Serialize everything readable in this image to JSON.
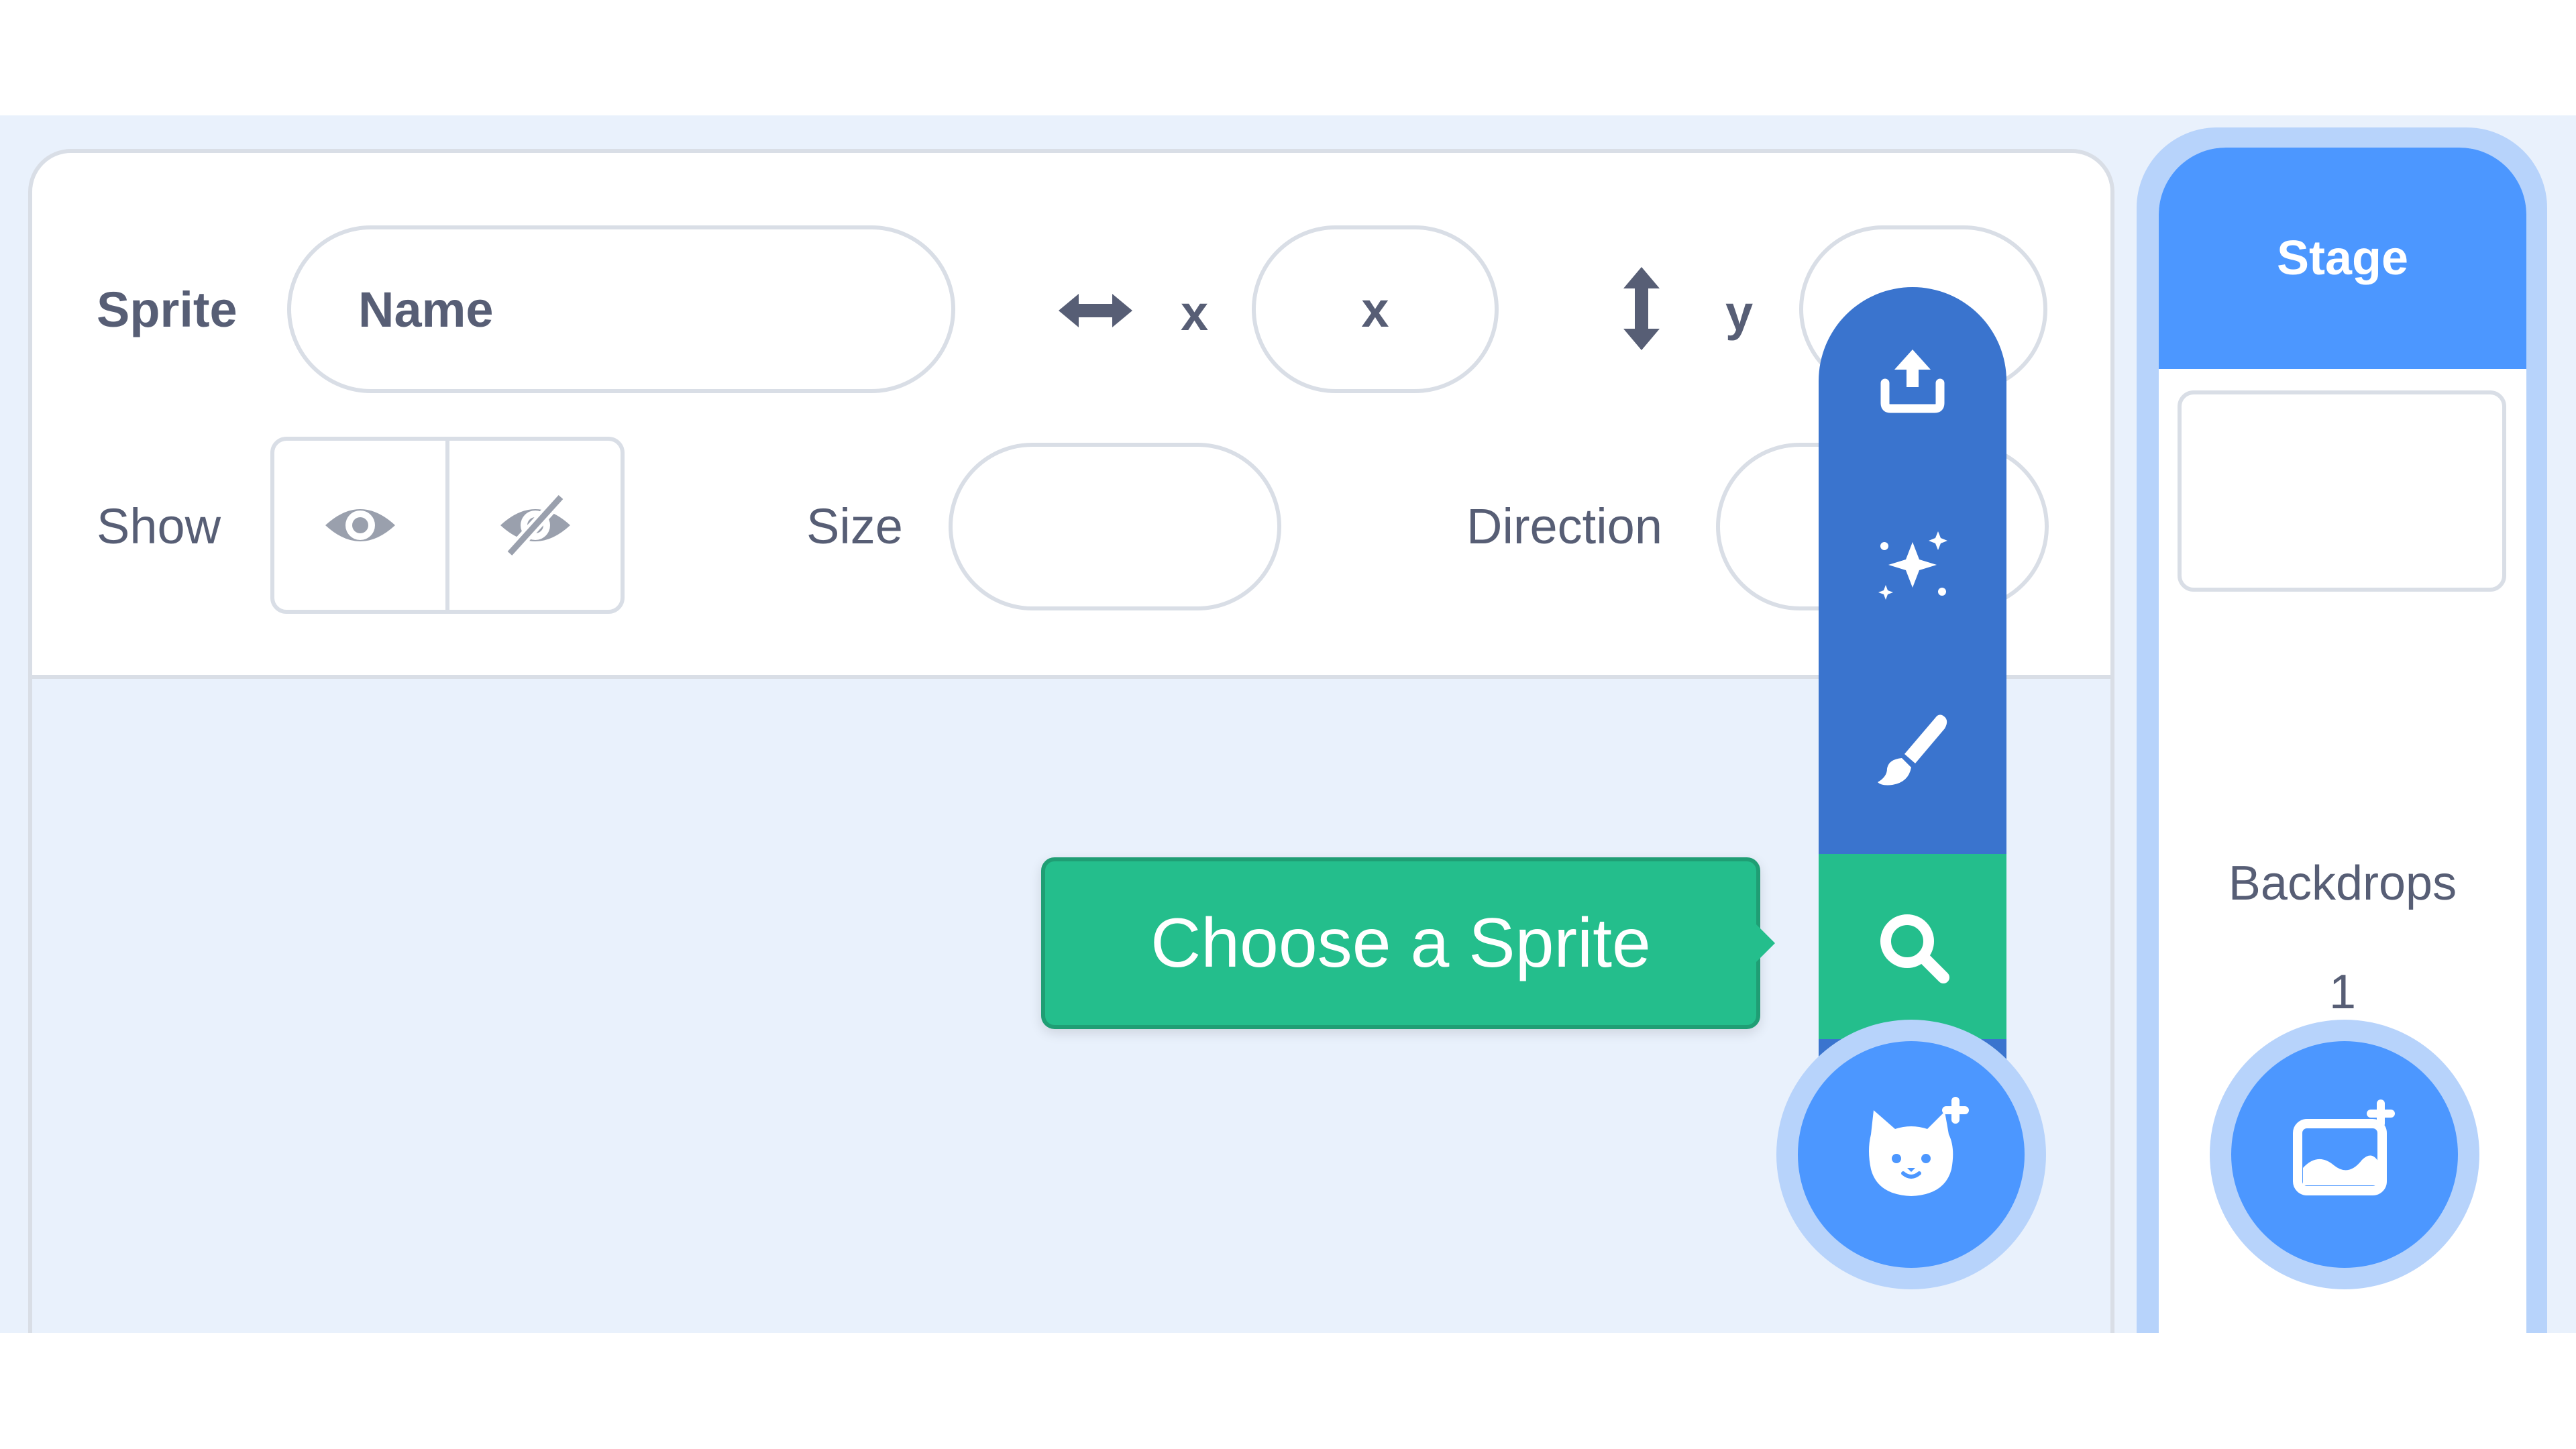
{
  "sprite_info": {
    "sprite_label": "Sprite",
    "name_placeholder": "Name",
    "x_label": "x",
    "x_placeholder": "x",
    "y_label": "y",
    "show_label": "Show",
    "size_label": "Size",
    "direction_label": "Direction"
  },
  "sprite_menu": {
    "items": [
      {
        "name": "upload-sprite",
        "icon": "upload-icon"
      },
      {
        "name": "surprise",
        "icon": "sparkles-icon"
      },
      {
        "name": "paint",
        "icon": "paintbrush-icon"
      },
      {
        "name": "choose-sprite",
        "icon": "search-icon",
        "active": true
      }
    ],
    "tooltip": "Choose a Sprite",
    "fab_icon": "cat-add-icon"
  },
  "stage": {
    "header": "Stage",
    "backdrops_label": "Backdrops",
    "backdrops_count": "1",
    "fab_icon": "backdrop-add-icon"
  },
  "colors": {
    "menu_blue": "#3a74ce",
    "primary_blue": "#4c97ff",
    "halo_blue": "#b7d3fb",
    "active_green": "#24be8c",
    "text_gray": "#575e75",
    "background": "#e9f1fc"
  }
}
